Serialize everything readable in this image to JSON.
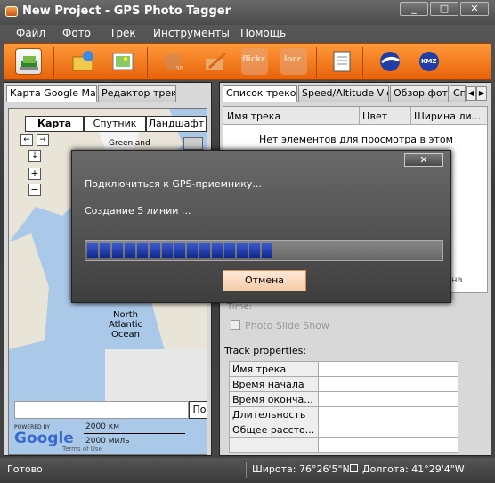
{
  "window": {
    "title": "New Project - GPS Photo Tagger",
    "controls": [
      "_",
      "□",
      "✕"
    ]
  },
  "menu": [
    "Файл",
    "Фото",
    "Трек",
    "Инструменты",
    "Помощь"
  ],
  "toolbar": {
    "tools": [
      "add-photos-icon",
      "folder-icon",
      "photos-icon",
      "globe-icon",
      "edit-icon",
      "flickr-icon",
      "locr-icon",
      "document-icon",
      "google-earth-icon",
      "kmz-icon"
    ],
    "flickr_label": "flickr",
    "locr_label": "locr",
    "kmz_label": "KMZ",
    "colors": {
      "bg_top": "#ff9a3a",
      "bg_bottom": "#e8620a"
    }
  },
  "left_tabs": [
    "Карта Google Map",
    "Редактор трека"
  ],
  "map": {
    "types": [
      "Карта",
      "Спутник",
      "Ландшафт"
    ],
    "labels": {
      "greenland": "Greenland",
      "ocean": "North\nAtlantic\nOcean"
    },
    "search_button": "По",
    "scale_km": "2000 км",
    "scale_mi": "2000 миль",
    "powered": "POWERED BY",
    "google": "Google",
    "terms": "Terms of Use"
  },
  "right_tabs": [
    "Список треков",
    "Speed/Altitude View",
    "Обзор фото",
    "Сп"
  ],
  "track_list": {
    "columns": [
      "Имя трека",
      "Цвет",
      "Ширина ли..."
    ],
    "empty": "Нет элементов для просмотра в этом"
  },
  "behind_dialog": {
    "checkbox": "Photo Slide Show",
    "time_label": "Time:",
    "side_text": "на"
  },
  "track_properties": {
    "title": "Track properties:",
    "rows": [
      "Имя трека",
      "Время начала",
      "Время оконча...",
      "Длительность",
      "Общее рассто..."
    ]
  },
  "status": {
    "left": "Готово",
    "lat": "Широта: 76°26'5\"N",
    "lon": "Долгота: 41°29'4\"W"
  },
  "dialog": {
    "line1": "Подключиться к GPS-приемнику...",
    "line2": "Создание 5 линии ...",
    "progress": 0.52,
    "progress_color": "#1e3ab0",
    "cancel": "Отмена",
    "close": "✕"
  }
}
